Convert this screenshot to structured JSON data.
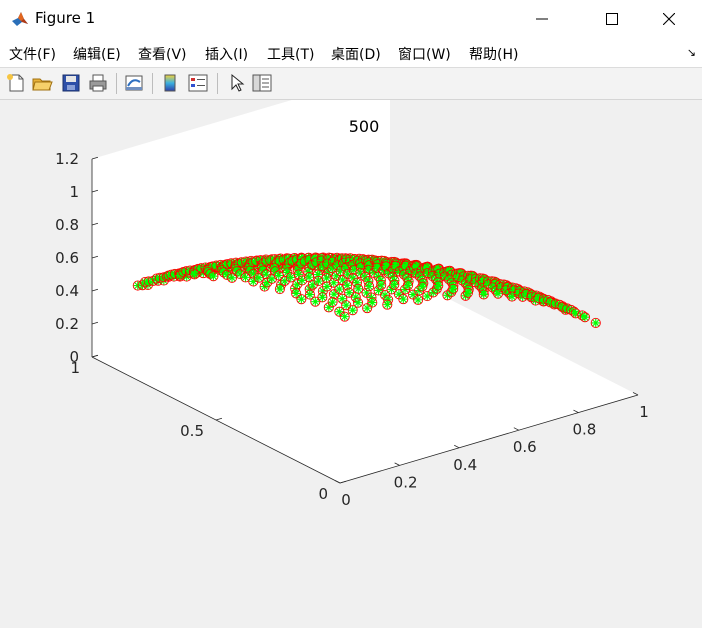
{
  "window": {
    "title": "Figure 1"
  },
  "menu": [
    {
      "label": "文件(F)"
    },
    {
      "label": "编辑(E)"
    },
    {
      "label": "查看(V)"
    },
    {
      "label": "插入(I)"
    },
    {
      "label": "工具(T)"
    },
    {
      "label": "桌面(D)"
    },
    {
      "label": "窗口(W)"
    },
    {
      "label": "帮助(H)"
    }
  ],
  "toolbar": {
    "icons": [
      "new-figure-icon",
      "open-file-icon",
      "save-icon",
      "print-icon",
      "link-plot-icon",
      "insert-colorbar-icon",
      "insert-legend-icon",
      "edit-plot-icon",
      "property-inspector-icon"
    ]
  },
  "colors": {
    "marker_circle": "#ff0000",
    "marker_star": "#00ff00",
    "axes_face": "#ffffff",
    "figure_bg": "#f0f0f0"
  },
  "chart_data": {
    "type": "scatter",
    "projection": "3d",
    "title": "500",
    "xlabel": "",
    "ylabel": "",
    "zlabel": "",
    "xlim": [
      0,
      1
    ],
    "ylim": [
      0,
      1
    ],
    "zlim": [
      0,
      1.2
    ],
    "xticks": [
      "0",
      "0.2",
      "0.4",
      "0.6",
      "0.8",
      "1"
    ],
    "yticks": [
      "0",
      "0.5",
      "1"
    ],
    "zticks": [
      "0",
      "0.2",
      "0.4",
      "0.6",
      "0.8",
      "1",
      "1.2"
    ],
    "grid": false,
    "point_count": 500,
    "surface": "first octant of unit sphere: x^2 + y^2 + z^2 = 1, x,y,z >= 0",
    "markers": [
      {
        "shape": "circle",
        "color": "#ff0000"
      },
      {
        "shape": "star",
        "color": "#00ff00"
      }
    ]
  }
}
